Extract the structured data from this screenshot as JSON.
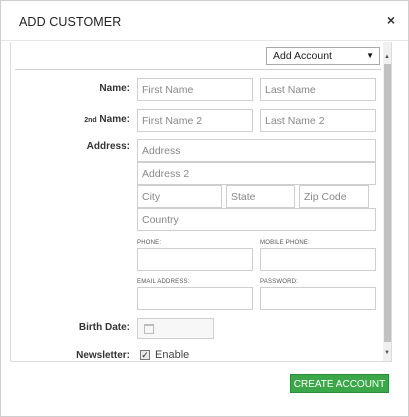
{
  "modal": {
    "title": "ADD CUSTOMER",
    "close_label": "×"
  },
  "account_select": {
    "selected": "Add Account",
    "caret": "▼"
  },
  "form": {
    "name_label": "Name:",
    "second_name_label_prefix": "2nd",
    "second_name_label": "Name:",
    "first_name_placeholder": "First Name",
    "last_name_placeholder": "Last Name",
    "first_name2_placeholder": "First Name 2",
    "last_name2_placeholder": "Last Name 2",
    "address_label": "Address:",
    "address_placeholder": "Address",
    "address2_placeholder": "Address 2",
    "city_placeholder": "City",
    "state_placeholder": "State",
    "zip_placeholder": "Zip Code",
    "country_placeholder": "Country",
    "phone_label": "PHONE:",
    "mobile_phone_label": "MOBILE PHONE:",
    "email_label": "EMAIL ADDRESS:",
    "password_label": "PASSWORD:",
    "birth_date_label": "Birth Date:",
    "newsletter_label": "Newsletter:",
    "newsletter_checked_mark": "✓",
    "newsletter_option": "Enable"
  },
  "footer": {
    "create_button": "CREATE ACCOUNT",
    "create_button_color": "#3aa848"
  },
  "icons": {
    "calendar": "calendar-icon",
    "close": "close-icon"
  }
}
